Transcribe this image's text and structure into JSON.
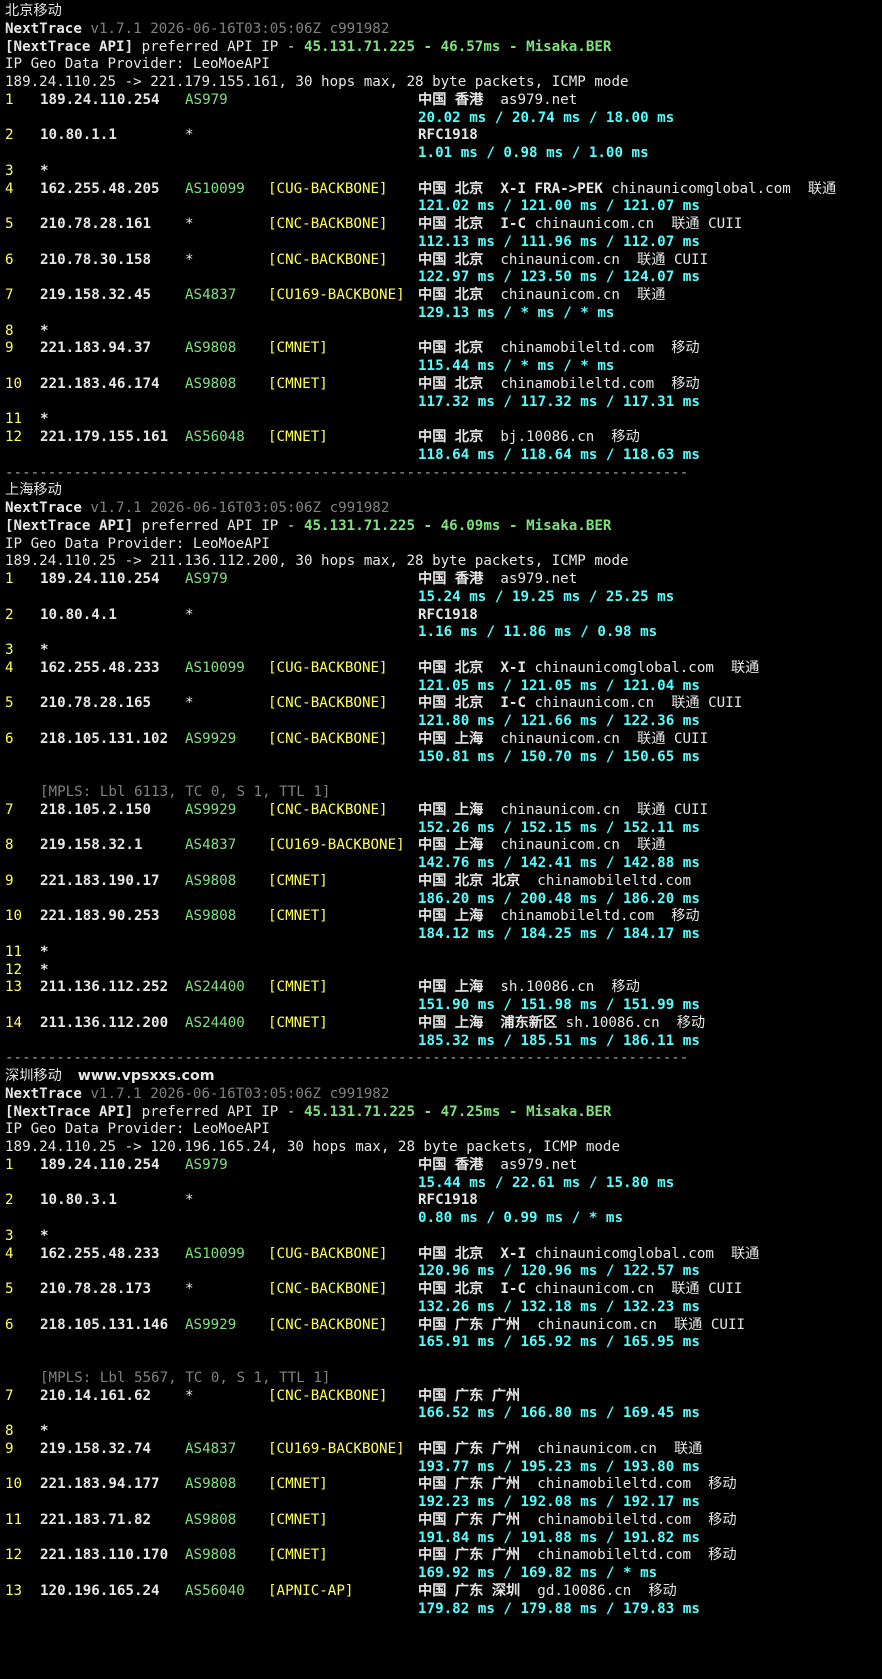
{
  "sections": [
    {
      "title": "北京移动",
      "app": "NextTrace",
      "version": "v1.7.1 2026-06-16T03:05:06Z c991982",
      "api_prefix": "[NextTrace API]",
      "api_mid": " preferred API IP - ",
      "api_ip": "45.131.71.225",
      "api_sep1": " - ",
      "api_ms": "46.57ms",
      "api_sep2": " - ",
      "api_node": "Misaka.BER",
      "geo_provider": "IP Geo Data Provider: LeoMoeAPI",
      "trace_line": "189.24.110.25 -> 221.179.155.161, 30 hops max, 28 byte packets, ICMP mode",
      "hops": [
        {
          "n": "1",
          "ip": "189.24.110.254",
          "asn": "AS979",
          "tag": "",
          "geo_bold": "中国 香港",
          "geo_rest": "  as979.net",
          "lat": "20.02 ms / 20.74 ms / 18.00 ms"
        },
        {
          "n": "2",
          "ip": "10.80.1.1",
          "asn": "*",
          "tag": "",
          "geo_bold": "RFC1918",
          "geo_rest": "",
          "lat": "1.01 ms / 0.98 ms / 1.00 ms"
        },
        {
          "n": "3",
          "ip": "*",
          "star": true
        },
        {
          "n": "4",
          "ip": "162.255.48.205",
          "asn": "AS10099",
          "tag": "[CUG-BACKBONE]",
          "geo_bold": "中国 北京  X-I FRA->PEK",
          "geo_rest": " chinaunicomglobal.com  联通",
          "lat": "121.02 ms / 121.00 ms / 121.07 ms"
        },
        {
          "n": "5",
          "ip": "210.78.28.161",
          "asn": "*",
          "tag": "[CNC-BACKBONE]",
          "geo_bold": "中国 北京  I-C",
          "geo_rest": " chinaunicom.cn  联通 CUII",
          "lat": "112.13 ms / 111.96 ms / 112.07 ms"
        },
        {
          "n": "6",
          "ip": "210.78.30.158",
          "asn": "*",
          "tag": "[CNC-BACKBONE]",
          "geo_bold": "中国 北京",
          "geo_rest": "  chinaunicom.cn  联通 CUII",
          "lat": "122.97 ms / 123.50 ms / 124.07 ms"
        },
        {
          "n": "7",
          "ip": "219.158.32.45",
          "asn": "AS4837",
          "tag": "[CU169-BACKBONE]",
          "geo_bold": "中国 北京",
          "geo_rest": "  chinaunicom.cn  联通",
          "lat": "129.13 ms / * ms / * ms"
        },
        {
          "n": "8",
          "ip": "*",
          "star": true
        },
        {
          "n": "9",
          "ip": "221.183.94.37",
          "asn": "AS9808",
          "tag": "[CMNET]",
          "geo_bold": "中国 北京",
          "geo_rest": "  chinamobileltd.com  移动",
          "lat": "115.44 ms / * ms / * ms"
        },
        {
          "n": "10",
          "ip": "221.183.46.174",
          "asn": "AS9808",
          "tag": "[CMNET]",
          "geo_bold": "中国 北京",
          "geo_rest": "  chinamobileltd.com  移动",
          "lat": "117.32 ms / 117.32 ms / 117.31 ms"
        },
        {
          "n": "11",
          "ip": "*",
          "star": true
        },
        {
          "n": "12",
          "ip": "221.179.155.161",
          "asn": "AS56048",
          "tag": "[CMNET]",
          "geo_bold": "中国 北京",
          "geo_rest": "  bj.10086.cn  移动",
          "lat": "118.64 ms / 118.64 ms / 118.63 ms"
        }
      ]
    },
    {
      "title": "上海移动",
      "app": "NextTrace",
      "version": "v1.7.1 2026-06-16T03:05:06Z c991982",
      "api_prefix": "[NextTrace API]",
      "api_mid": " preferred API IP - ",
      "api_ip": "45.131.71.225",
      "api_sep1": " - ",
      "api_ms": "46.09ms",
      "api_sep2": " - ",
      "api_node": "Misaka.BER",
      "geo_provider": "IP Geo Data Provider: LeoMoeAPI",
      "trace_line": "189.24.110.25 -> 211.136.112.200, 30 hops max, 28 byte packets, ICMP mode",
      "hops": [
        {
          "n": "1",
          "ip": "189.24.110.254",
          "asn": "AS979",
          "tag": "",
          "geo_bold": "中国 香港",
          "geo_rest": "  as979.net",
          "lat": "15.24 ms / 19.25 ms / 25.25 ms"
        },
        {
          "n": "2",
          "ip": "10.80.4.1",
          "asn": "*",
          "tag": "",
          "geo_bold": "RFC1918",
          "geo_rest": "",
          "lat": "1.16 ms / 11.86 ms / 0.98 ms"
        },
        {
          "n": "3",
          "ip": "*",
          "star": true
        },
        {
          "n": "4",
          "ip": "162.255.48.233",
          "asn": "AS10099",
          "tag": "[CUG-BACKBONE]",
          "geo_bold": "中国 北京  X-I",
          "geo_rest": " chinaunicomglobal.com  联通",
          "lat": "121.05 ms / 121.05 ms / 121.04 ms"
        },
        {
          "n": "5",
          "ip": "210.78.28.165",
          "asn": "*",
          "tag": "[CNC-BACKBONE]",
          "geo_bold": "中国 北京  I-C",
          "geo_rest": " chinaunicom.cn  联通 CUII",
          "lat": "121.80 ms / 121.66 ms / 122.36 ms"
        },
        {
          "n": "6",
          "ip": "218.105.131.102",
          "asn": "AS9929",
          "tag": "[CNC-BACKBONE]",
          "geo_bold": "中国 上海",
          "geo_rest": "  chinaunicom.cn  联通 CUII",
          "lat": "150.81 ms / 150.70 ms / 150.65 ms",
          "mpls": "[MPLS: Lbl 6113, TC 0, S 1, TTL 1]"
        },
        {
          "n": "7",
          "ip": "218.105.2.150",
          "asn": "AS9929",
          "tag": "[CNC-BACKBONE]",
          "geo_bold": "中国 上海",
          "geo_rest": "  chinaunicom.cn  联通 CUII",
          "lat": "152.26 ms / 152.15 ms / 152.11 ms"
        },
        {
          "n": "8",
          "ip": "219.158.32.1",
          "asn": "AS4837",
          "tag": "[CU169-BACKBONE]",
          "geo_bold": "中国 上海",
          "geo_rest": "  chinaunicom.cn  联通",
          "lat": "142.76 ms / 142.41 ms / 142.88 ms"
        },
        {
          "n": "9",
          "ip": "221.183.190.17",
          "asn": "AS9808",
          "tag": "[CMNET]",
          "geo_bold": "中国 北京 北京",
          "geo_rest": "  chinamobileltd.com",
          "lat": "186.20 ms / 200.48 ms / 186.20 ms"
        },
        {
          "n": "10",
          "ip": "221.183.90.253",
          "asn": "AS9808",
          "tag": "[CMNET]",
          "geo_bold": "中国 上海",
          "geo_rest": "  chinamobileltd.com  移动",
          "lat": "184.12 ms / 184.25 ms / 184.17 ms"
        },
        {
          "n": "11",
          "ip": "*",
          "star": true,
          "compact": true
        },
        {
          "n": "12",
          "ip": "*",
          "star": true
        },
        {
          "n": "13",
          "ip": "211.136.112.252",
          "asn": "AS24400",
          "tag": "[CMNET]",
          "geo_bold": "中国 上海",
          "geo_rest": "  sh.10086.cn  移动",
          "lat": "151.90 ms / 151.98 ms / 151.99 ms"
        },
        {
          "n": "14",
          "ip": "211.136.112.200",
          "asn": "AS24400",
          "tag": "[CMNET]",
          "geo_bold": "中国 上海  浦东新区",
          "geo_rest": " sh.10086.cn  移动",
          "lat": "185.32 ms / 185.51 ms / 186.11 ms"
        }
      ]
    },
    {
      "title": "深圳移动",
      "watermark": "www.vpsxxs.com",
      "app": "NextTrace",
      "version": "v1.7.1 2026-06-16T03:05:06Z c991982",
      "api_prefix": "[NextTrace API]",
      "api_mid": " preferred API IP - ",
      "api_ip": "45.131.71.225",
      "api_sep1": " - ",
      "api_ms": "47.25ms",
      "api_sep2": " - ",
      "api_node": "Misaka.BER",
      "geo_provider": "IP Geo Data Provider: LeoMoeAPI",
      "trace_line": "189.24.110.25 -> 120.196.165.24, 30 hops max, 28 byte packets, ICMP mode",
      "hops": [
        {
          "n": "1",
          "ip": "189.24.110.254",
          "asn": "AS979",
          "tag": "",
          "geo_bold": "中国 香港",
          "geo_rest": "  as979.net",
          "lat": "15.44 ms / 22.61 ms / 15.80 ms"
        },
        {
          "n": "2",
          "ip": "10.80.3.1",
          "asn": "*",
          "tag": "",
          "geo_bold": "RFC1918",
          "geo_rest": "",
          "lat": "0.80 ms / 0.99 ms / * ms"
        },
        {
          "n": "3",
          "ip": "*",
          "star": true
        },
        {
          "n": "4",
          "ip": "162.255.48.233",
          "asn": "AS10099",
          "tag": "[CUG-BACKBONE]",
          "geo_bold": "中国 北京  X-I",
          "geo_rest": " chinaunicomglobal.com  联通",
          "lat": "120.96 ms / 120.96 ms / 122.57 ms"
        },
        {
          "n": "5",
          "ip": "210.78.28.173",
          "asn": "*",
          "tag": "[CNC-BACKBONE]",
          "geo_bold": "中国 北京  I-C",
          "geo_rest": " chinaunicom.cn  联通 CUII",
          "lat": "132.26 ms / 132.18 ms / 132.23 ms"
        },
        {
          "n": "6",
          "ip": "218.105.131.146",
          "asn": "AS9929",
          "tag": "[CNC-BACKBONE]",
          "geo_bold": "中国 广东 广州",
          "geo_rest": "  chinaunicom.cn  联通 CUII",
          "lat": "165.91 ms / 165.92 ms / 165.95 ms",
          "mpls": "[MPLS: Lbl 5567, TC 0, S 1, TTL 1]"
        },
        {
          "n": "7",
          "ip": "210.14.161.62",
          "asn": "*",
          "tag": "[CNC-BACKBONE]",
          "geo_bold": "中国 广东 广州",
          "geo_rest": "",
          "lat": "166.52 ms / 166.80 ms / 169.45 ms"
        },
        {
          "n": "8",
          "ip": "*",
          "star": true
        },
        {
          "n": "9",
          "ip": "219.158.32.74",
          "asn": "AS4837",
          "tag": "[CU169-BACKBONE]",
          "geo_bold": "中国 广东 广州",
          "geo_rest": "  chinaunicom.cn  联通",
          "lat": "193.77 ms / 195.23 ms / 193.80 ms"
        },
        {
          "n": "10",
          "ip": "221.183.94.177",
          "asn": "AS9808",
          "tag": "[CMNET]",
          "geo_bold": "中国 广东 广州",
          "geo_rest": "  chinamobileltd.com  移动",
          "lat": "192.23 ms / 192.08 ms / 192.17 ms"
        },
        {
          "n": "11",
          "ip": "221.183.71.82",
          "asn": "AS9808",
          "tag": "[CMNET]",
          "geo_bold": "中国 广东 广州",
          "geo_rest": "  chinamobileltd.com  移动",
          "lat": "191.84 ms / 191.88 ms / 191.82 ms"
        },
        {
          "n": "12",
          "ip": "221.183.110.170",
          "asn": "AS9808",
          "tag": "[CMNET]",
          "geo_bold": "中国 广东 广州",
          "geo_rest": "  chinamobileltd.com  移动",
          "lat": "169.92 ms / 169.82 ms / * ms"
        },
        {
          "n": "13",
          "ip": "120.196.165.24",
          "asn": "AS56040",
          "tag": "[APNIC-AP]",
          "geo_bold": "中国 广东 深圳",
          "geo_rest": "  gd.10086.cn  移动",
          "lat": "179.82 ms / 179.88 ms / 179.83 ms"
        }
      ]
    }
  ],
  "separator": "--------------------------------------------------------------------------------"
}
